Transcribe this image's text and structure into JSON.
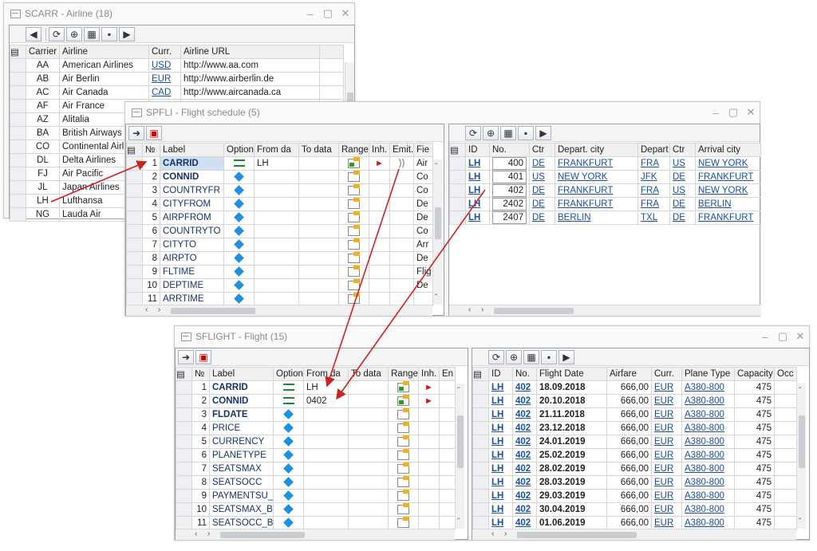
{
  "scarr": {
    "title": "SCARR - Airline (18)",
    "headers": [
      "Carrier",
      "Airline",
      "Curr.",
      "Airline URL"
    ],
    "rows": [
      [
        "AA",
        "American Airlines",
        "USD",
        "http://www.aa.com"
      ],
      [
        "AB",
        "Air Berlin",
        "EUR",
        "http://www.airberlin.de"
      ],
      [
        "AC",
        "Air Canada",
        "CAD",
        "http://www.aircanada.ca"
      ],
      [
        "AF",
        "Air France",
        "",
        ""
      ],
      [
        "AZ",
        "Alitalia",
        "",
        ""
      ],
      [
        "BA",
        "British Airways",
        "",
        ""
      ],
      [
        "CO",
        "Continental Airlin",
        "",
        ""
      ],
      [
        "DL",
        "Delta Airlines",
        "",
        ""
      ],
      [
        "FJ",
        "Air Pacific",
        "",
        ""
      ],
      [
        "JL",
        "Japan Airlines",
        "",
        ""
      ],
      [
        "LH",
        "Lufthansa",
        "",
        ""
      ],
      [
        "NG",
        "Lauda Air",
        "",
        ""
      ]
    ]
  },
  "spfli": {
    "title": "SPFLI - Flight schedule (5)",
    "headers": [
      "№",
      "Label",
      "Option",
      "From da",
      "To data",
      "Range",
      "Inh.",
      "Emit.",
      "Fie"
    ],
    "rows": [
      [
        "1",
        "CARRID",
        "eq",
        "LH",
        "",
        "g",
        "red",
        "wave",
        "Air"
      ],
      [
        "2",
        "CONNID",
        "dia",
        "",
        "",
        "",
        "",
        "",
        "Co"
      ],
      [
        "3",
        "COUNTRYFR",
        "dia",
        "",
        "",
        "",
        "",
        "",
        "Co"
      ],
      [
        "4",
        "CITYFROM",
        "dia",
        "",
        "",
        "",
        "",
        "",
        "De"
      ],
      [
        "5",
        "AIRPFROM",
        "dia",
        "",
        "",
        "",
        "",
        "",
        "De"
      ],
      [
        "6",
        "COUNTRYTO",
        "dia",
        "",
        "",
        "",
        "",
        "",
        "Co"
      ],
      [
        "7",
        "CITYTO",
        "dia",
        "",
        "",
        "",
        "",
        "",
        "Arr"
      ],
      [
        "8",
        "AIRPTO",
        "dia",
        "",
        "",
        "",
        "",
        "",
        "De"
      ],
      [
        "9",
        "FLTIME",
        "dia",
        "",
        "",
        "",
        "",
        "",
        "Flig"
      ],
      [
        "10",
        "DEPTIME",
        "dia",
        "",
        "",
        "",
        "",
        "",
        "De"
      ],
      [
        "11",
        "ARRTIME",
        "dia",
        "",
        "",
        "",
        "",
        "",
        ""
      ]
    ],
    "right_headers": [
      "ID",
      "No.",
      "Ctr",
      "Depart. city",
      "Depart",
      "Ctr",
      "Arrival city"
    ],
    "right_rows": [
      [
        "LH",
        "400",
        "DE",
        "FRANKFURT",
        "FRA",
        "US",
        "NEW YORK"
      ],
      [
        "LH",
        "401",
        "US",
        "NEW YORK",
        "JFK",
        "DE",
        "FRANKFURT"
      ],
      [
        "LH",
        "402",
        "DE",
        "FRANKFURT",
        "FRA",
        "US",
        "NEW YORK"
      ],
      [
        "LH",
        "2402",
        "DE",
        "FRANKFURT",
        "FRA",
        "DE",
        "BERLIN"
      ],
      [
        "LH",
        "2407",
        "DE",
        "BERLIN",
        "TXL",
        "DE",
        "FRANKFURT"
      ]
    ]
  },
  "sflight": {
    "title": "SFLIGHT - Flight (15)",
    "headers": [
      "№",
      "Label",
      "Option",
      "From da",
      "To data",
      "Range",
      "Inh.",
      "En"
    ],
    "rows": [
      [
        "1",
        "CARRID",
        "eq",
        "LH",
        "",
        "g",
        "red"
      ],
      [
        "2",
        "CONNID",
        "eq",
        "0402",
        "",
        "g",
        "red"
      ],
      [
        "3",
        "FLDATE",
        "dia",
        "",
        "",
        "",
        ""
      ],
      [
        "4",
        "PRICE",
        "dia",
        "",
        "",
        "",
        ""
      ],
      [
        "5",
        "CURRENCY",
        "dia",
        "",
        "",
        "",
        ""
      ],
      [
        "6",
        "PLANETYPE",
        "dia",
        "",
        "",
        "",
        ""
      ],
      [
        "7",
        "SEATSMAX",
        "dia",
        "",
        "",
        "",
        ""
      ],
      [
        "8",
        "SEATSOCC",
        "dia",
        "",
        "",
        "",
        ""
      ],
      [
        "9",
        "PAYMENTSU_",
        "dia",
        "",
        "",
        "",
        ""
      ],
      [
        "10",
        "SEATSMAX_B",
        "dia",
        "",
        "",
        "",
        ""
      ],
      [
        "11",
        "SEATSOCC_B",
        "dia",
        "",
        "",
        "",
        ""
      ]
    ],
    "right_headers": [
      "ID",
      "No.",
      "Flight Date",
      "Airfare",
      "Curr.",
      "Plane Type",
      "Capacity",
      "Occ"
    ],
    "right_rows": [
      [
        "LH",
        "402",
        "18.09.2018",
        "666,00",
        "EUR",
        "A380-800",
        "475"
      ],
      [
        "LH",
        "402",
        "20.10.2018",
        "666,00",
        "EUR",
        "A380-800",
        "475"
      ],
      [
        "LH",
        "402",
        "21.11.2018",
        "666,00",
        "EUR",
        "A380-800",
        "475"
      ],
      [
        "LH",
        "402",
        "23.12.2018",
        "666,00",
        "EUR",
        "A380-800",
        "475"
      ],
      [
        "LH",
        "402",
        "24.01.2019",
        "666,00",
        "EUR",
        "A380-800",
        "475"
      ],
      [
        "LH",
        "402",
        "25.02.2019",
        "666,00",
        "EUR",
        "A380-800",
        "475"
      ],
      [
        "LH",
        "402",
        "28.02.2019",
        "666,00",
        "EUR",
        "A380-800",
        "475"
      ],
      [
        "LH",
        "402",
        "28.03.2019",
        "666,00",
        "EUR",
        "A380-800",
        "475"
      ],
      [
        "LH",
        "402",
        "29.03.2019",
        "666,00",
        "EUR",
        "A380-800",
        "475"
      ],
      [
        "LH",
        "402",
        "30.04.2019",
        "666,00",
        "EUR",
        "A380-800",
        "475"
      ],
      [
        "LH",
        "402",
        "01.06.2019",
        "666,00",
        "EUR",
        "A380-800",
        "475"
      ]
    ]
  },
  "colors": {
    "accent": "#15336b",
    "link": "#1a4fa3",
    "arrow": "#d02020",
    "selected": "#cfe0f3"
  }
}
